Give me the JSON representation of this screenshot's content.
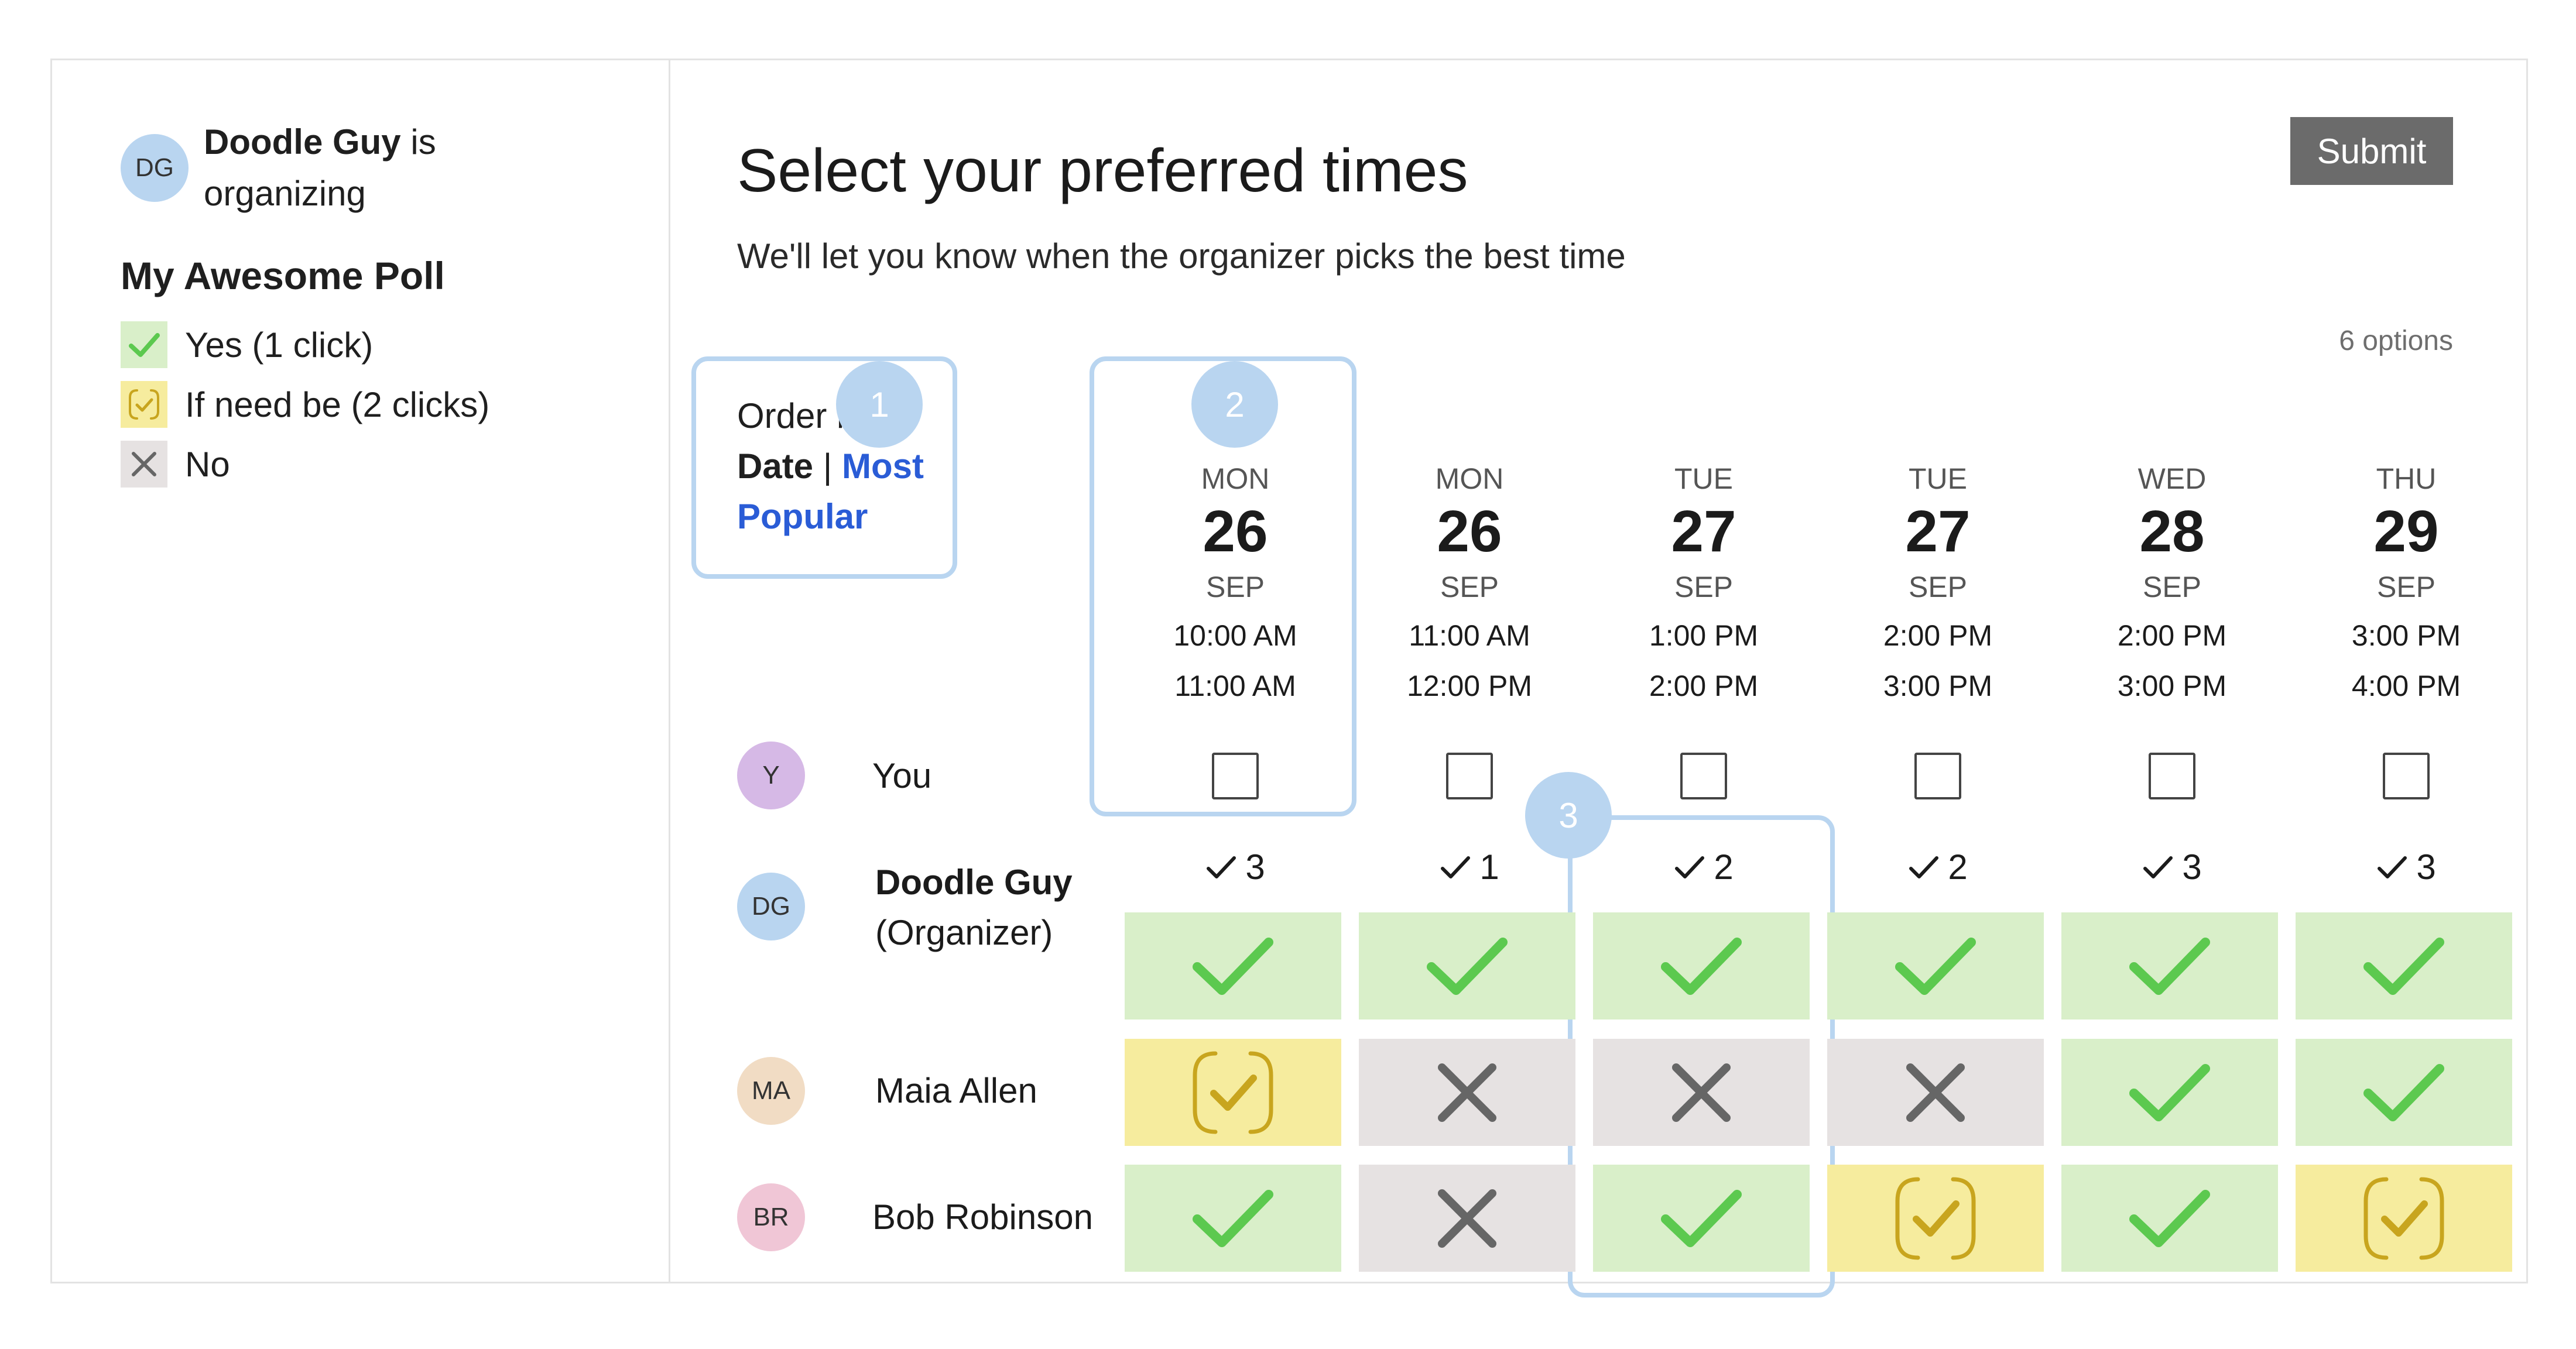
{
  "sidebar": {
    "organizer_initials": "DG",
    "organizer_name": "Doodle Guy",
    "organizer_suffix": " is organizing",
    "poll_title": "My Awesome Poll",
    "legend": [
      {
        "key": "yes",
        "label": "Yes (1 click)"
      },
      {
        "key": "maybe",
        "label": "If need be (2 clicks)"
      },
      {
        "key": "no",
        "label": "No"
      }
    ]
  },
  "main": {
    "title": "Select your preferred times",
    "subtitle": "We'll let you know when the organizer picks the best time",
    "submit_label": "Submit",
    "options_count": "6 options",
    "order_by": {
      "prefix": "Order by",
      "date": "Date",
      "separator": " | ",
      "popular": "Most Popular"
    },
    "steps": [
      "1",
      "2",
      "3"
    ]
  },
  "columns": [
    {
      "dow": "MON",
      "day": "26",
      "month": "SEP",
      "start": "10:00 AM",
      "end": "11:00 AM",
      "tally": "3"
    },
    {
      "dow": "MON",
      "day": "26",
      "month": "SEP",
      "start": "11:00 AM",
      "end": "12:00 PM",
      "tally": "1"
    },
    {
      "dow": "TUE",
      "day": "27",
      "month": "SEP",
      "start": "1:00 PM",
      "end": "2:00 PM",
      "tally": "2"
    },
    {
      "dow": "TUE",
      "day": "27",
      "month": "SEP",
      "start": "2:00 PM",
      "end": "3:00 PM",
      "tally": "2"
    },
    {
      "dow": "WED",
      "day": "28",
      "month": "SEP",
      "start": "2:00 PM",
      "end": "3:00 PM",
      "tally": "3"
    },
    {
      "dow": "THU",
      "day": "29",
      "month": "SEP",
      "start": "3:00 PM",
      "end": "4:00 PM",
      "tally": "3"
    }
  ],
  "you": {
    "initials": "Y",
    "name": "You"
  },
  "participants": [
    {
      "initials": "DG",
      "name": "Doodle Guy",
      "role": "(Organizer)",
      "votes": [
        "yes",
        "yes",
        "yes",
        "yes",
        "yes",
        "yes"
      ]
    },
    {
      "initials": "MA",
      "name": "Maia Allen",
      "role": "",
      "votes": [
        "maybe",
        "no",
        "no",
        "no",
        "yes",
        "yes"
      ]
    },
    {
      "initials": "BR",
      "name": "Bob Robinson",
      "role": "",
      "votes": [
        "yes",
        "no",
        "yes",
        "maybe",
        "yes",
        "maybe"
      ]
    }
  ],
  "colors": {
    "yes_bg": "#d9efc9",
    "yes_mark": "#5cc94f",
    "maybe_bg": "#f6ec9e",
    "maybe_mark": "#c8a51e",
    "no_bg": "#e6e2e2",
    "no_mark": "#666666",
    "highlight": "#b9d5f0",
    "link": "#2a5cd6",
    "submit_bg": "#6b6b6b"
  },
  "icons": {
    "yes": "check-icon",
    "maybe": "maybe-check-icon",
    "no": "x-icon",
    "tally": "checkmark-icon"
  }
}
